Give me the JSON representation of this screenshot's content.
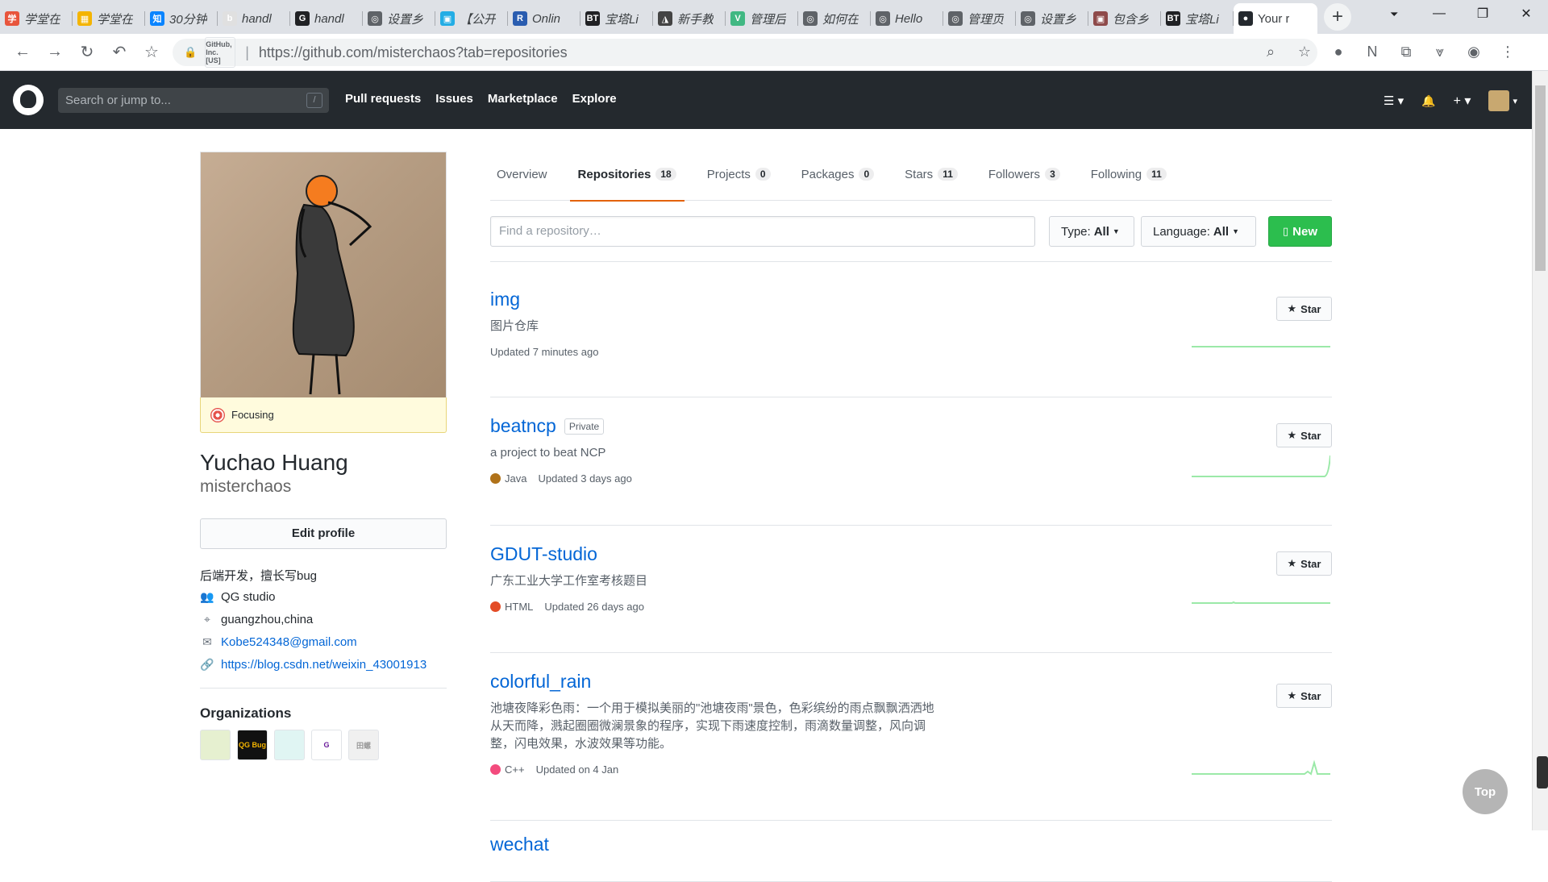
{
  "browser": {
    "tabs": [
      {
        "title": "学堂在",
        "color": "#e8553c",
        "glyph": "学"
      },
      {
        "title": "学堂在",
        "color": "#f4b400",
        "glyph": "▦"
      },
      {
        "title": "30分钟",
        "color": "#0a84ff",
        "glyph": "知"
      },
      {
        "title": "handl",
        "color": "#e0e0e0",
        "glyph": "b"
      },
      {
        "title": "handl",
        "color": "#202124",
        "glyph": "G"
      },
      {
        "title": "设置乡",
        "color": "#5f6368",
        "glyph": "◎"
      },
      {
        "title": "【公开",
        "color": "#23ade5",
        "glyph": "▣"
      },
      {
        "title": "Onlin",
        "color": "#2a5db0",
        "glyph": "R"
      },
      {
        "title": "宝塔Li",
        "color": "#202124",
        "glyph": "BT"
      },
      {
        "title": "新手教",
        "color": "#444",
        "glyph": "◮"
      },
      {
        "title": "管理后",
        "color": "#41b883",
        "glyph": "V"
      },
      {
        "title": "如何在",
        "color": "#5f6368",
        "glyph": "◎"
      },
      {
        "title": "Hello",
        "color": "#5f6368",
        "glyph": "◎"
      },
      {
        "title": "管理页",
        "color": "#5f6368",
        "glyph": "◎"
      },
      {
        "title": "设置乡",
        "color": "#5f6368",
        "glyph": "◎"
      },
      {
        "title": "包含乡",
        "color": "#8e4a4a",
        "glyph": "▣"
      },
      {
        "title": "宝塔Li",
        "color": "#202124",
        "glyph": "BT"
      }
    ],
    "active_tab": {
      "title": "Your r",
      "glyph": "●"
    },
    "new_tab": "+",
    "tab_menu": "⏷",
    "window_controls": {
      "minimize": "—",
      "maximize": "❐",
      "close": "✕"
    },
    "nav": {
      "back": "←",
      "forward": "→",
      "reload": "↻",
      "undo": "↶",
      "bookmark": "☆"
    },
    "security_org": "GitHub, Inc. [US]",
    "url_sep": "|",
    "url": "https://github.com/misterchaos?tab=repositories",
    "lock": "🔒",
    "right_icons": [
      "⌕",
      "☆",
      "●",
      "N",
      "⧉",
      "⩔",
      "◉",
      "⋮"
    ]
  },
  "github": {
    "search_placeholder": "Search or jump to...",
    "search_key": "/",
    "nav": [
      "Pull requests",
      "Issues",
      "Marketplace",
      "Explore"
    ],
    "right": {
      "menu": "☰ ▾",
      "bell": "🔔",
      "plus": "+ ▾",
      "avatar_caret": "▾"
    }
  },
  "profile": {
    "status": "Focusing",
    "full_name": "Yuchao Huang",
    "username": "misterchaos",
    "edit_label": "Edit profile",
    "bio": "后端开发，擅长写bug",
    "company": "QG studio",
    "location": "guangzhou,china",
    "email": "Kobe524348@gmail.com",
    "website": "https://blog.csdn.net/weixin_43001913",
    "orgs_title": "Organizations",
    "orgs": [
      {
        "label": "",
        "bg": "#e6f0d0",
        "fg": "#8bc34a"
      },
      {
        "label": "QG Bug",
        "bg": "#111",
        "fg": "#f4b400"
      },
      {
        "label": "",
        "bg": "#e0f5f3",
        "fg": "#80cbc4"
      },
      {
        "label": "G",
        "bg": "#fff",
        "fg": "#6a1b9a"
      },
      {
        "label": "田螺",
        "bg": "#f0f0f0",
        "fg": "#999"
      }
    ],
    "icons": {
      "company": "👥",
      "location": "⌖",
      "email": "✉",
      "link": "🔗"
    }
  },
  "tabs": [
    {
      "label": "Overview",
      "count": ""
    },
    {
      "label": "Repositories",
      "count": "18"
    },
    {
      "label": "Projects",
      "count": "0"
    },
    {
      "label": "Packages",
      "count": "0"
    },
    {
      "label": "Stars",
      "count": "11"
    },
    {
      "label": "Followers",
      "count": "3"
    },
    {
      "label": "Following",
      "count": "11"
    }
  ],
  "filter": {
    "placeholder": "Find a repository…",
    "type_label": "Type:",
    "type_value": "All",
    "language_label": "Language:",
    "language_value": "All",
    "new_label": "New"
  },
  "repos": [
    {
      "name": "img",
      "private": "",
      "desc": "图片仓库",
      "lang": "",
      "lang_color": "",
      "updated": "Updated 7 minutes ago",
      "star": "Star"
    },
    {
      "name": "beatncp",
      "private": "Private",
      "desc": "a project to beat NCP",
      "lang": "Java",
      "lang_color": "#b07219",
      "updated": "Updated 3 days ago",
      "star": "Star"
    },
    {
      "name": "GDUT-studio",
      "private": "",
      "desc": "广东工业大学工作室考核题目",
      "lang": "HTML",
      "lang_color": "#e34c26",
      "updated": "Updated 26 days ago",
      "star": "Star"
    },
    {
      "name": "colorful_rain",
      "private": "",
      "desc": "池塘夜降彩色雨：一个用于模拟美丽的\"池塘夜雨\"景色，色彩缤纷的雨点飘飘洒洒地从天而降，溅起圈圈微澜景象的程序，实现下雨速度控制，雨滴数量调整，风向调整，闪电效果，水波效果等功能。",
      "lang": "C++",
      "lang_color": "#f34b7d",
      "updated": "Updated on 4 Jan",
      "star": "Star"
    },
    {
      "name": "wechat",
      "private": "",
      "desc": "",
      "lang": "",
      "lang_color": "",
      "updated": "",
      "star": ""
    }
  ],
  "top_button": "Top",
  "accent_colors": {
    "header": "#24292e",
    "link": "#0366d6",
    "new_button": "#2cbe4e",
    "tab_underline": "#e36209"
  }
}
